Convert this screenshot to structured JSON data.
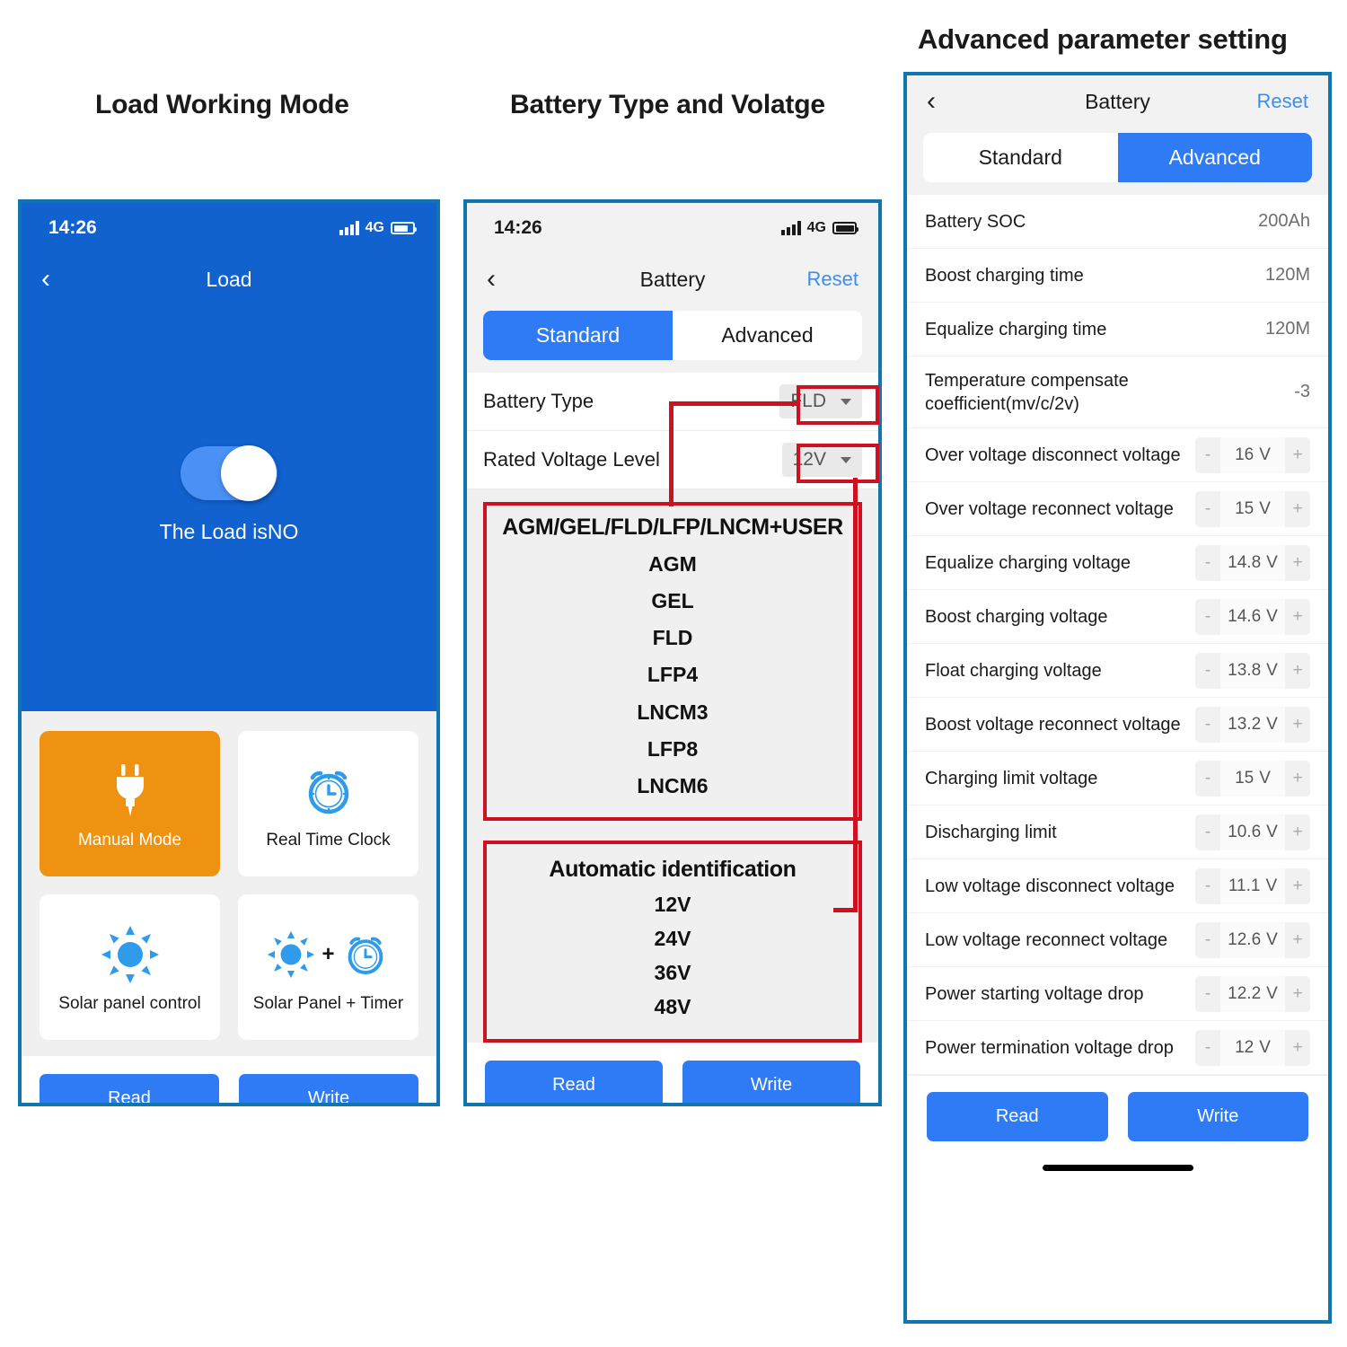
{
  "headings": {
    "load": "Load Working Mode",
    "battery": "Battery Type and Volatge",
    "advanced": "Advanced parameter setting"
  },
  "status_bar": {
    "time": "14:26",
    "network": "4G"
  },
  "load_screen": {
    "nav": {
      "title": "Load",
      "back_icon": "chevron-left-icon"
    },
    "toggle_state_label": "The Load isNO",
    "modes": [
      {
        "label": "Manual Mode",
        "icon": "power-plug-icon",
        "active": true
      },
      {
        "label": "Real Time Clock",
        "icon": "alarm-clock-icon",
        "active": false
      },
      {
        "label": "Solar panel control",
        "icon": "sun-icon",
        "active": false
      },
      {
        "label": "Solar Panel + Timer",
        "icon": "sun-plus-clock-icon",
        "active": false
      }
    ],
    "buttons": {
      "read": "Read",
      "write": "Write"
    }
  },
  "battery_screen": {
    "nav": {
      "title": "Battery",
      "reset": "Reset",
      "back_icon": "chevron-left-icon"
    },
    "tabs": [
      {
        "label": "Standard",
        "active": true
      },
      {
        "label": "Advanced",
        "active": false
      }
    ],
    "rows": [
      {
        "label": "Battery Type",
        "value": "FLD"
      },
      {
        "label": "Rated Voltage Level",
        "value": "12V"
      }
    ],
    "callout_type": {
      "header": "AGM/GEL/FLD/LFP/LNCM+USER",
      "items": [
        "AGM",
        "GEL",
        "FLD",
        "LFP4",
        "LNCM3",
        "LFP8",
        "LNCM6"
      ]
    },
    "callout_voltage": {
      "header": "Automatic identification",
      "items": [
        "12V",
        "24V",
        "36V",
        "48V"
      ]
    },
    "buttons": {
      "read": "Read",
      "write": "Write"
    }
  },
  "advanced_screen": {
    "nav": {
      "title": "Battery",
      "reset": "Reset",
      "back_icon": "chevron-left-icon"
    },
    "tabs": [
      {
        "label": "Standard",
        "active": false
      },
      {
        "label": "Advanced",
        "active": true
      }
    ],
    "rows": [
      {
        "label": "Battery SOC",
        "value": "200Ah",
        "type": "text"
      },
      {
        "label": "Boost charging time",
        "value": "120M",
        "type": "text"
      },
      {
        "label": "Equalize charging time",
        "value": "120M",
        "type": "text"
      },
      {
        "label": "Temperature compensate coefficient(mv/c/2v)",
        "value": "-3",
        "type": "text"
      },
      {
        "label": "Over voltage disconnect voltage",
        "value": "16",
        "unit": "V",
        "type": "stepper"
      },
      {
        "label": "Over voltage reconnect voltage",
        "value": "15",
        "unit": "V",
        "type": "stepper"
      },
      {
        "label": "Equalize charging voltage",
        "value": "14.8",
        "unit": "V",
        "type": "stepper"
      },
      {
        "label": "Boost charging voltage",
        "value": "14.6",
        "unit": "V",
        "type": "stepper"
      },
      {
        "label": "Float charging voltage",
        "value": "13.8",
        "unit": "V",
        "type": "stepper"
      },
      {
        "label": "Boost voltage reconnect voltage",
        "value": "13.2",
        "unit": "V",
        "type": "stepper"
      },
      {
        "label": "Charging limit voltage",
        "value": "15",
        "unit": "V",
        "type": "stepper"
      },
      {
        "label": "Discharging limit",
        "value": "10.6",
        "unit": "V",
        "type": "stepper"
      },
      {
        "label": "Low voltage disconnect voltage",
        "value": "11.1",
        "unit": "V",
        "type": "stepper"
      },
      {
        "label": "Low voltage reconnect voltage",
        "value": "12.6",
        "unit": "V",
        "type": "stepper"
      },
      {
        "label": "Power starting voltage drop",
        "value": "12.2",
        "unit": "V",
        "type": "stepper"
      },
      {
        "label": "Power termination voltage drop",
        "value": "12",
        "unit": "V",
        "type": "stepper"
      }
    ],
    "stepper_minus": "-",
    "stepper_plus": "+",
    "buttons": {
      "read": "Read",
      "write": "Write"
    }
  },
  "colors": {
    "frame_border": "#1175b0",
    "callout_red": "#cf1020",
    "primary_blue": "#2f7bf6",
    "header_blue": "#1161cf",
    "accent_orange": "#ef9211",
    "icon_blue": "#2f9ceb"
  }
}
